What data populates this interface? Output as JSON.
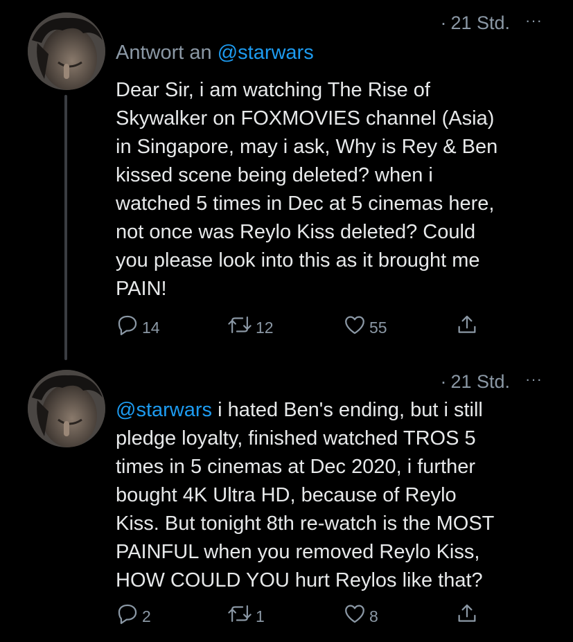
{
  "tweets": [
    {
      "time": "21 Std.",
      "more": "···",
      "reply_prefix": "Antwort an",
      "reply_handle": "@starwars",
      "mention": "",
      "text": "Dear Sir, i am watching The Rise of\nSkywalker on FOXMOVIES channel (Asia)\nin Singapore, may i ask, Why is Rey & Ben\nkissed scene being deleted? when i\nwatched 5 times in Dec at 5 cinemas here,\nnot once was Reylo Kiss deleted? Could\nyou please look into this as it brought me\nPAIN!",
      "replies": "14",
      "retweets": "12",
      "likes": "55"
    },
    {
      "time": "21 Std.",
      "more": "···",
      "mention": "@starwars",
      "text": " i hated Ben's ending, but i still\npledge loyalty, finished watched TROS 5\ntimes in 5 cinemas at Dec 2020, i further\nbought 4K Ultra HD, because of Reylo\nKiss. But tonight 8th re-watch is the MOST\nPAINFUL when you removed Reylo Kiss,\nHOW COULD YOU hurt Reylos like that?",
      "replies": "2",
      "retweets": "1",
      "likes": "8"
    }
  ],
  "colors": {
    "background": "#000000",
    "text": "#e7e9ea",
    "secondary": "#8b98a5",
    "link": "#1d9bf0",
    "thread_line": "#3a3d42"
  },
  "icons": [
    "avatar",
    "reply-icon",
    "retweet-icon",
    "like-icon",
    "share-icon",
    "more-icon"
  ]
}
